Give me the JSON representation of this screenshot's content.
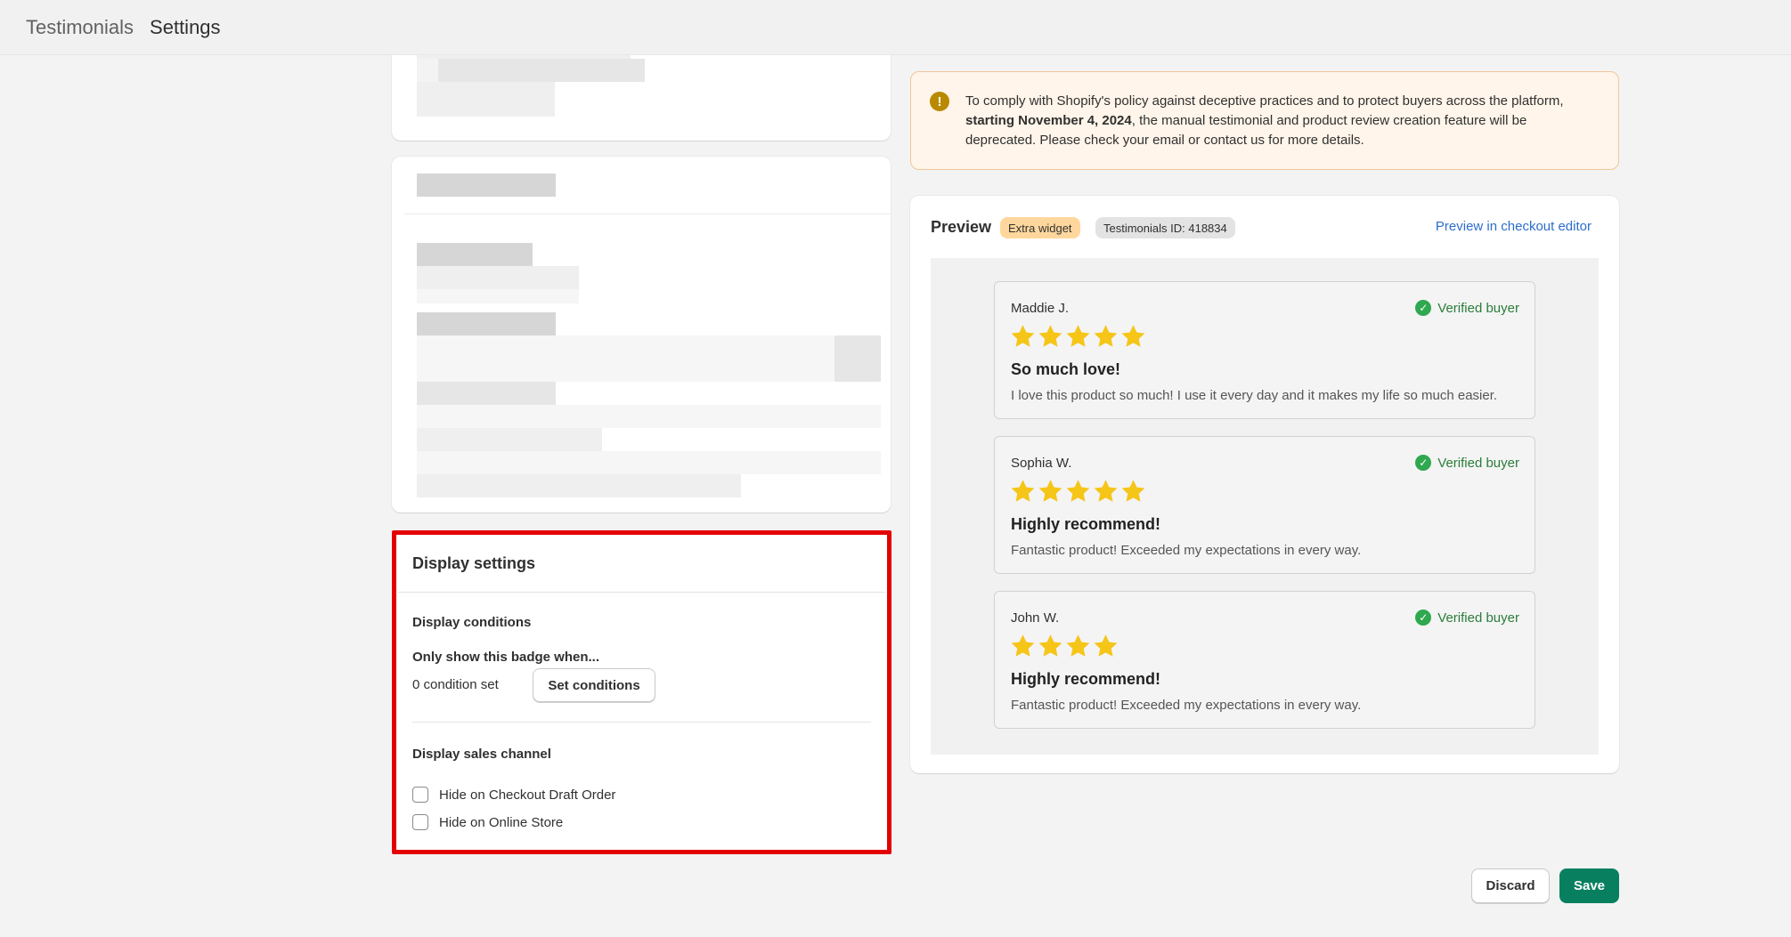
{
  "breadcrumb": {
    "parent": "Testimonials",
    "current": "Settings"
  },
  "display_settings": {
    "title": "Display settings",
    "conditions_heading": "Display conditions",
    "only_show_label": "Only show this badge when...",
    "condition_count": "0 condition set",
    "set_conditions_label": "Set conditions",
    "sales_channel_heading": "Display sales channel",
    "checkboxes": [
      {
        "label": "Hide on Checkout Draft Order",
        "checked": false
      },
      {
        "label": "Hide on Online Store",
        "checked": false
      }
    ]
  },
  "banner": {
    "icon": "exclamation-icon",
    "text_before": "To comply with Shopify's policy against deceptive practices and to protect buyers across the platform, ",
    "text_bold": "starting November 4, 2024",
    "text_after": ", the manual testimonial and product review creation feature will be deprecated. Please check your email or contact us for more details."
  },
  "preview": {
    "title": "Preview",
    "badge_extra": "Extra widget",
    "badge_id": "Testimonials ID: 418834",
    "editor_link": "Preview in checkout editor",
    "reviews": [
      {
        "name": "Maddie J.",
        "verified": "Verified buyer",
        "stars": 5,
        "title": "So much love!",
        "body": "I love this product so much! I use it every day and it makes my life so much easier."
      },
      {
        "name": "Sophia W.",
        "verified": "Verified buyer",
        "stars": 5,
        "title": "Highly recommend!",
        "body": "Fantastic product! Exceeded my expectations in every way."
      },
      {
        "name": "John W.",
        "verified": "Verified buyer",
        "stars": 4,
        "title": "Highly recommend!",
        "body": "Fantastic product! Exceeded my expectations in every way."
      }
    ]
  },
  "footer": {
    "discard_label": "Discard",
    "save_label": "Save"
  },
  "colors": {
    "accent_save": "#088060",
    "highlight_border": "#e30000",
    "star": "#f5c518",
    "link": "#2c6ecb",
    "verified": "#2fa84f"
  }
}
